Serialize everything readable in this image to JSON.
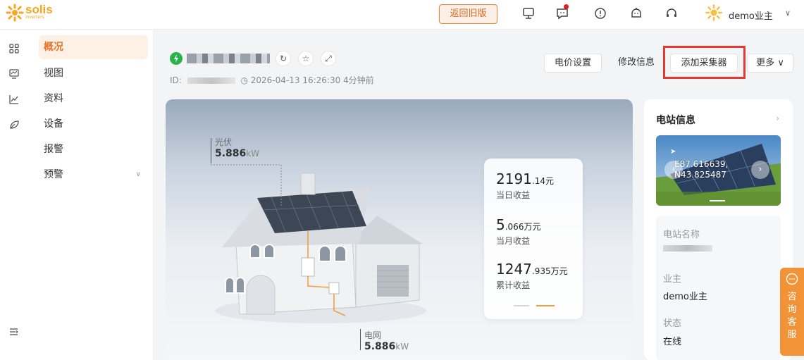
{
  "header": {
    "logo": {
      "main": "solis",
      "sub": "inverters"
    },
    "back_old_label": "返回旧版",
    "icons": [
      "monitor-icon",
      "message-icon",
      "info-icon",
      "robot-icon",
      "headset-icon"
    ],
    "user_name": "demo业主",
    "accent_color": "#e8762a"
  },
  "sidebar": {
    "items": [
      {
        "label": "概况"
      },
      {
        "label": "视图"
      },
      {
        "label": "资料"
      },
      {
        "label": "设备"
      },
      {
        "label": "报警"
      },
      {
        "label": "预警"
      }
    ]
  },
  "plant": {
    "id_label": "ID:",
    "timestamp": "◷ 2026-04-13 16:26:30 4分钟前",
    "actions": [
      "电价设置",
      "修改信息",
      "添加采集器",
      "更多"
    ]
  },
  "flow": {
    "pv_label": "光伏",
    "pv_value": "5.886",
    "pv_unit": "kW",
    "grid_label": "电网",
    "grid_value": "5.886",
    "grid_unit": "kW"
  },
  "income": [
    {
      "big": "2191",
      "small": ".14元",
      "label": "当日收益"
    },
    {
      "big": "5",
      "small": ".066万元",
      "label": "当月收益"
    },
    {
      "big": "1247",
      "small": ".935万元",
      "label": "累计收益"
    }
  ],
  "station": {
    "title": "电站信息",
    "more": "›",
    "coord_line1": "E87.616639,",
    "coord_line2": "N43.825487",
    "name_label": "电站名称",
    "owner_label": "业主",
    "owner_value": "demo业主",
    "status_label": "状态",
    "status_value": "在线"
  },
  "consult": {
    "chars": [
      "咨",
      "询",
      "客",
      "服"
    ]
  }
}
